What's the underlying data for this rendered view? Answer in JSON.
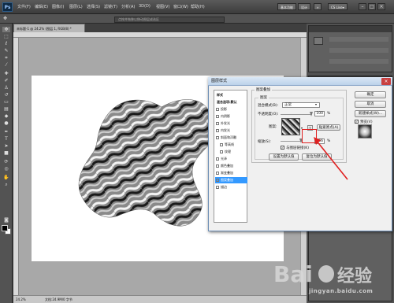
{
  "app": {
    "logo_text": "Ps"
  },
  "menu": [
    "文件(F)",
    "编辑(E)",
    "图像(I)",
    "图层(L)",
    "选择(S)",
    "滤镜(T)",
    "分析(A)",
    "3D(D)",
    "视图(V)",
    "窗口(W)",
    "帮助(H)"
  ],
  "workspace": {
    "basic": "基本功能",
    "design": "设计",
    "more": "»",
    "cslive": "CS Live▾"
  },
  "window_buttons": [
    "–",
    "□",
    "×"
  ],
  "options_bar": {
    "hint": "点按并拖移以移动图层或选区"
  },
  "document": {
    "tab_title": "未标题-1 @ 24.2% (图层 1, RGB/8) *",
    "zoom": "24.2%",
    "status": "文档:24.9M/0 字节"
  },
  "dialog": {
    "title": "图层样式",
    "styles_list": [
      {
        "label": "样式",
        "type": "head"
      },
      {
        "label": "混合选项:默认",
        "type": "head"
      },
      {
        "label": "投影",
        "checked": false
      },
      {
        "label": "内阴影",
        "checked": false
      },
      {
        "label": "外发光",
        "checked": false
      },
      {
        "label": "内发光",
        "checked": false
      },
      {
        "label": "斜面和浮雕",
        "checked": false
      },
      {
        "label": "等高线",
        "checked": false,
        "indent": true
      },
      {
        "label": "纹理",
        "checked": false,
        "indent": true
      },
      {
        "label": "光泽",
        "checked": false
      },
      {
        "label": "颜色叠加",
        "checked": false
      },
      {
        "label": "渐变叠加",
        "checked": false
      },
      {
        "label": "图案叠加",
        "checked": true,
        "selected": true
      },
      {
        "label": "描边",
        "checked": false
      }
    ],
    "group_title": "图案叠加",
    "subgroup_title": "图案",
    "blend_mode_label": "混合模式(B):",
    "blend_mode_value": "正常",
    "opacity_label": "不透明度(O):",
    "opacity_value": "100",
    "opacity_unit": "%",
    "pattern_label": "图案:",
    "snap_button": "贴紧原点(A)",
    "scale_label": "缩放(S):",
    "scale_value": "666",
    "scale_unit": "%",
    "link_label": "与图层链接(K)",
    "default_button": "设置为默认值",
    "reset_button": "复位为默认值",
    "ok_button": "确定",
    "cancel_button": "取消",
    "new_style_button": "新建样式(W)...",
    "preview_label": "预览(V)"
  },
  "watermark": {
    "brand": "Bai 经验",
    "url": "jingyan.baidu.com"
  },
  "colors": {
    "highlight": "#e02020",
    "selection": "#3399ff"
  }
}
